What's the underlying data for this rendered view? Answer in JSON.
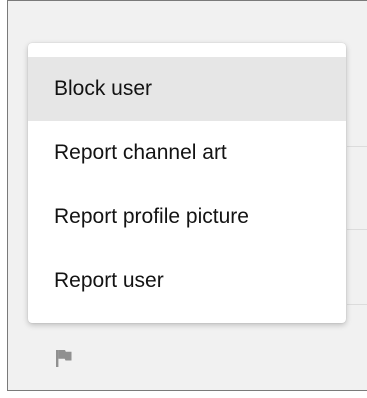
{
  "menu": {
    "items": [
      {
        "label": "Block user",
        "highlighted": true
      },
      {
        "label": "Report channel art",
        "highlighted": false
      },
      {
        "label": "Report profile picture",
        "highlighted": false
      },
      {
        "label": "Report user",
        "highlighted": false
      }
    ]
  },
  "footer": {
    "icon": "flag-icon"
  },
  "colors": {
    "menu_highlight": "#e6e6e6",
    "panel_background": "#f1f1f1",
    "icon_color": "#909090",
    "text_color": "#131313"
  }
}
